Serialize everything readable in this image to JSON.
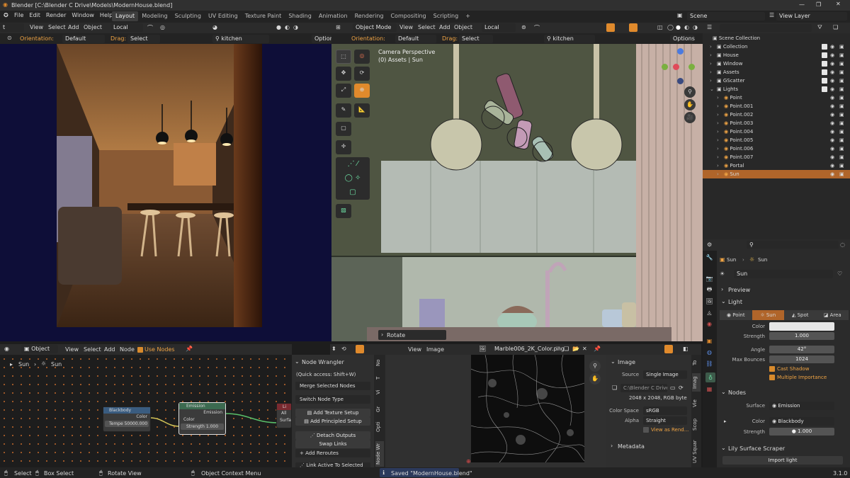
{
  "window": {
    "title": "Blender [C:\\Blender C Drive\\Models\\ModernHouse.blend]"
  },
  "menu": {
    "items": [
      "File",
      "Edit",
      "Render",
      "Window",
      "Help"
    ]
  },
  "workspaces": [
    "Layout",
    "Modeling",
    "Sculpting",
    "UV Editing",
    "Texture Paint",
    "Shading",
    "Animation",
    "Rendering",
    "Compositing",
    "Scripting"
  ],
  "scene": {
    "scene_label": "Scene",
    "view_layer_label": "View Layer"
  },
  "left_viewport": {
    "mode": "t Mode",
    "menu": [
      "View",
      "Select",
      "Add",
      "Object"
    ],
    "transform": "Local",
    "orientation_label": "Orientation:",
    "orientation_value": "Default",
    "drag_label": "Drag:",
    "drag_value": "Select Box",
    "search": "kitchen",
    "options": "Options"
  },
  "right_viewport": {
    "mode": "Object Mode",
    "menu": [
      "View",
      "Select",
      "Add",
      "Object"
    ],
    "transform": "Local",
    "orientation_label": "Orientation:",
    "orientation_value": "Default",
    "drag_label": "Drag:",
    "drag_value": "Select Box",
    "search": "kitchen",
    "options": "Options",
    "camera_text": "Camera Perspective",
    "camera_sub": "(0) Assets | Sun",
    "op_panel": "Rotate"
  },
  "outliner": {
    "root": "Scene Collection",
    "items": [
      {
        "name": "Collection",
        "indent": 1
      },
      {
        "name": "House",
        "indent": 1
      },
      {
        "name": "Window",
        "indent": 1
      },
      {
        "name": "Assets",
        "indent": 1
      },
      {
        "name": "GScatter",
        "indent": 1
      },
      {
        "name": "Lights",
        "indent": 1
      },
      {
        "name": "Point",
        "indent": 2
      },
      {
        "name": "Point.001",
        "indent": 2
      },
      {
        "name": "Point.002",
        "indent": 2
      },
      {
        "name": "Point.003",
        "indent": 2
      },
      {
        "name": "Point.004",
        "indent": 2
      },
      {
        "name": "Point.005",
        "indent": 2
      },
      {
        "name": "Point.006",
        "indent": 2
      },
      {
        "name": "Point.007",
        "indent": 2
      },
      {
        "name": "Portal",
        "indent": 2
      },
      {
        "name": "Sun",
        "indent": 2,
        "selected": true
      }
    ]
  },
  "properties": {
    "breadcrumb": [
      "Sun",
      "Sun"
    ],
    "datablock": "Sun",
    "preview_label": "Preview",
    "light_label": "Light",
    "light_types": [
      "Point",
      "Sun",
      "Spot",
      "Area"
    ],
    "active_type": "Sun",
    "color_label": "Color",
    "strength_label": "Strength",
    "strength_value": "1.000",
    "angle_label": "Angle",
    "angle_value": "42°",
    "max_bounces_label": "Max Bounces",
    "max_bounces_value": "1024",
    "cast_shadow": "Cast Shadow",
    "multiple_importance": "Multiple Importance",
    "nodes_label": "Nodes",
    "surface_label": "Surface",
    "surface_value": "Emission",
    "node_color_label": "Color",
    "node_color_value": "Blackbody",
    "node_strength_label": "Strength",
    "node_strength_value": "1.000",
    "addon_label": "Lily Surface Scraper",
    "import_light": "Import light"
  },
  "node_editor": {
    "object_dd": "Object",
    "menu": [
      "View",
      "Select",
      "Add",
      "Node"
    ],
    "use_nodes": "Use Nodes",
    "breadcrumb": [
      "Sun",
      "Sun"
    ],
    "blackbody": {
      "title": "Blackbody",
      "out": "Color",
      "temp_label": "Tempe",
      "temp_value": "50000.000"
    },
    "emission": {
      "title": "Emission",
      "out": "Emission",
      "color_in": "Color",
      "strength_label": "Strength",
      "strength_value": "1.000"
    },
    "output": {
      "title": "Li",
      "all": "All",
      "surf": "Surfa"
    }
  },
  "node_wrangler": {
    "title": "Node Wrangler",
    "quick_access": "(Quick access: Shift+W)",
    "merge": "Merge Selected Nodes",
    "switch": "Switch Node Type",
    "add_texture": "Add Texture Setup",
    "add_principled": "Add Principled Setup",
    "detach": "Detach Outputs",
    "swap": "Swap Links",
    "add_reroutes": "Add Reroutes",
    "link_active": "Link Active To Selected",
    "vtabs": [
      "No",
      "T",
      "Vi",
      "Gr",
      "Opti",
      "Node Wr"
    ]
  },
  "image_editor": {
    "menu": [
      "View",
      "Image"
    ],
    "image_name": "Marble006_2K_Color.png",
    "panel_title": "Image",
    "source_label": "Source",
    "source_value": "Single Image",
    "path": "C:\\Blender C Drive...",
    "info": "2048 x 2048,  RGB byte",
    "color_space_label": "Color Space",
    "color_space_value": "sRGB",
    "alpha_label": "Alpha",
    "alpha_value": "Straight",
    "view_as_render": "View as Rend...",
    "metadata": "Metadata",
    "vtabs": [
      "To",
      "Imag",
      "Vie",
      "Scop",
      "UV Squar"
    ]
  },
  "statusbar": {
    "select": "Select",
    "box_select": "Box Select",
    "rotate_view": "Rotate View",
    "context_menu": "Object Context Menu",
    "saved": "Saved \"ModernHouse.blend\"",
    "version": "3.1.0"
  },
  "colors": {
    "accent": "#e08a2c",
    "selection": "#b0652a",
    "viewport": "#4d5340",
    "render_bg": "#0d0d3a"
  }
}
